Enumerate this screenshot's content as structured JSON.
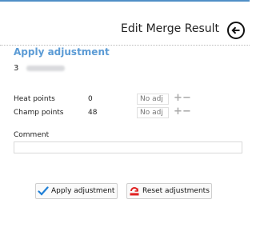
{
  "header": {
    "title": "Edit Merge Result",
    "back_icon": "arrow-left-circle-icon"
  },
  "section": {
    "title": "Apply adjustment",
    "record_number": "3"
  },
  "rows": [
    {
      "label": "Heat points",
      "value": "0",
      "adjust_placeholder": "No adj"
    },
    {
      "label": "Champ points",
      "value": "48",
      "adjust_placeholder": "No adj"
    }
  ],
  "comment": {
    "label": "Comment",
    "value": ""
  },
  "buttons": {
    "apply": {
      "label": "Apply adjustment",
      "icon": "checkmark-icon"
    },
    "reset": {
      "label": "Reset adjustments",
      "icon": "reset-icon"
    }
  },
  "colors": {
    "accent": "#5b9bd5",
    "check": "#1f7fd6",
    "reset": "#e02020"
  }
}
